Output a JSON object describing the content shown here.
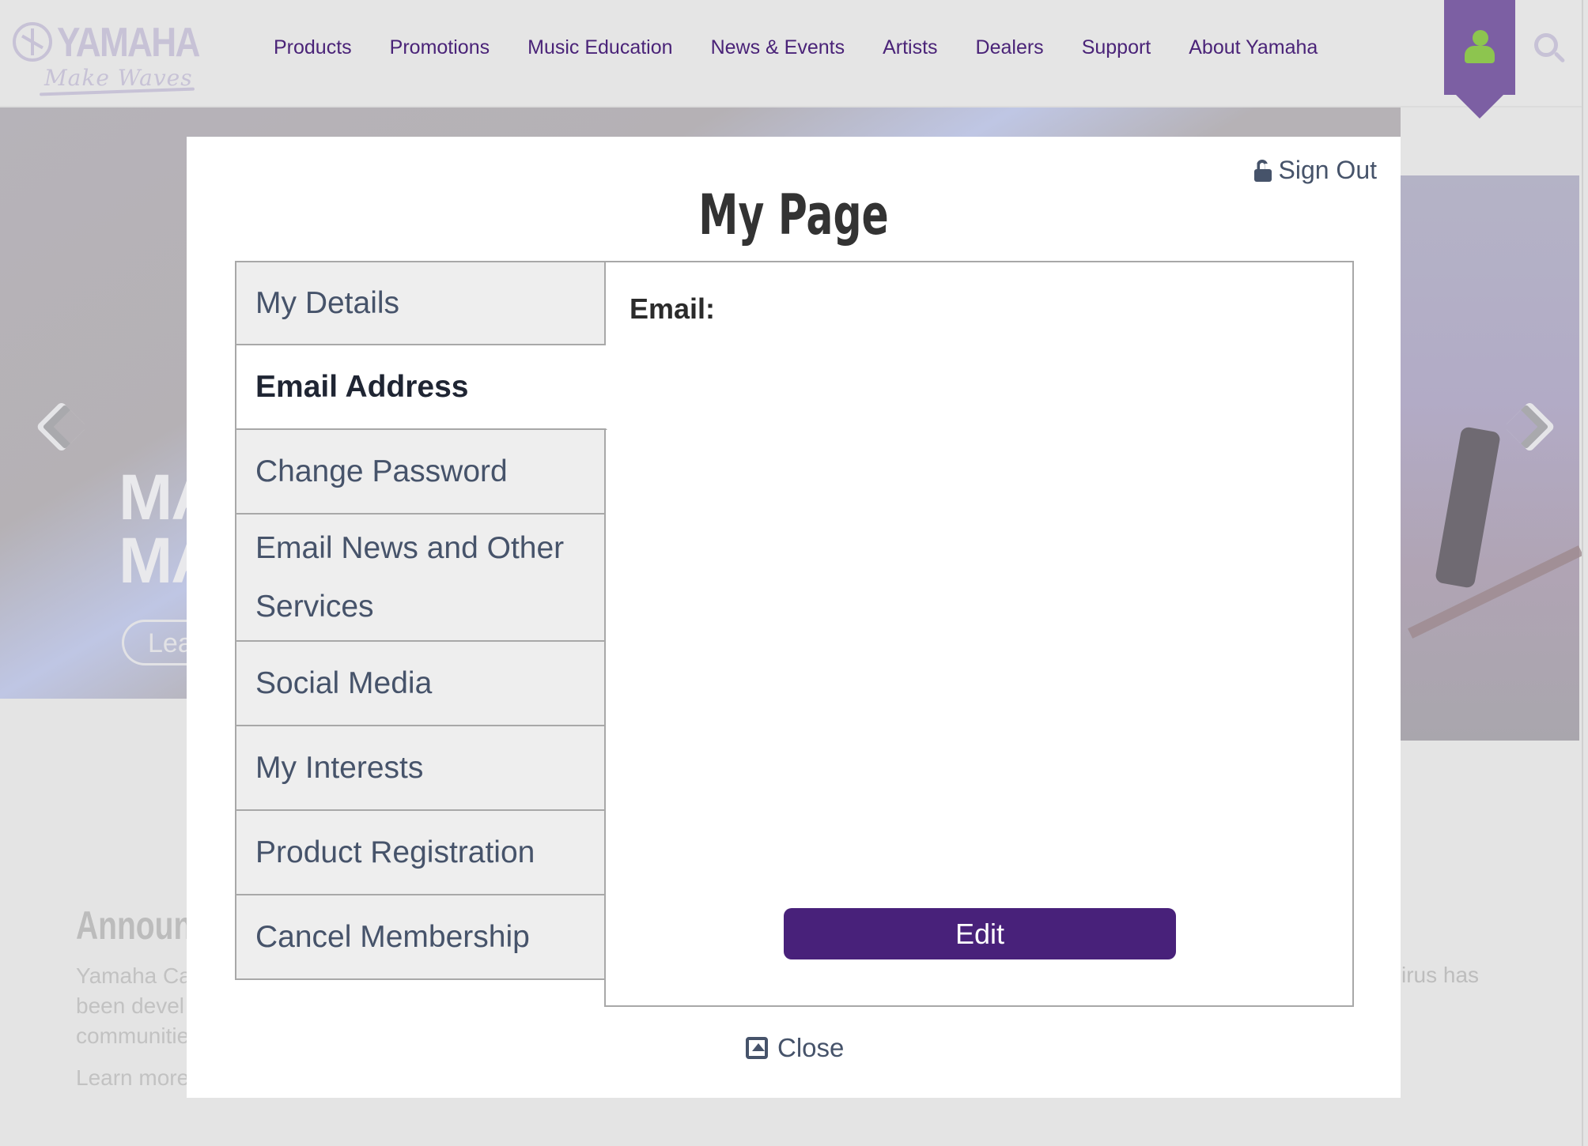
{
  "header": {
    "logo_word": "YAMAHA",
    "logo_tagline": "Make Waves",
    "nav": [
      "Products",
      "Promotions",
      "Music Education",
      "News & Events",
      "Artists",
      "Dealers",
      "Support",
      "About Yamaha"
    ],
    "account_icon": "user-icon",
    "search_icon": "search-icon"
  },
  "hero": {
    "title_line1": "MA",
    "title_line2": "MA",
    "button_label": "Lea"
  },
  "announcement": {
    "title": "Announc",
    "text": "Yamaha Ca been devel communitie",
    "more": "Learn more",
    "right_fragment": "irus has"
  },
  "modal": {
    "title": "My Page",
    "sign_out": "Sign Out",
    "tabs": [
      {
        "label": "My Details",
        "active": false
      },
      {
        "label": "Email Address",
        "active": true
      },
      {
        "label": "Change Password",
        "active": false
      },
      {
        "label": "Email News and Other Services",
        "active": false
      },
      {
        "label": "Social Media",
        "active": false
      },
      {
        "label": "My Interests",
        "active": false
      },
      {
        "label": "Product Registration",
        "active": false
      },
      {
        "label": "Cancel Membership",
        "active": false
      }
    ],
    "content": {
      "email_label": "Email:",
      "email_value": ""
    },
    "edit_label": "Edit",
    "close_label": "Close"
  },
  "colors": {
    "brand_purple": "#48217a",
    "account_tab": "#7c5fa3",
    "user_icon": "#8dc54f",
    "nav_text": "#4a2378"
  }
}
